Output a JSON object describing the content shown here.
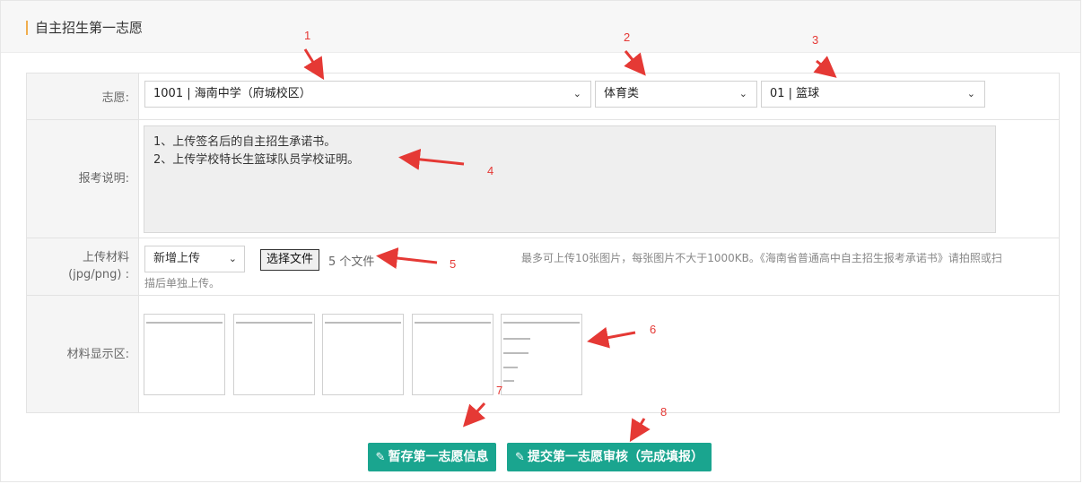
{
  "header": {
    "title": "自主招生第一志愿"
  },
  "form": {
    "choice": {
      "label": "志愿:",
      "school_value": "1001 | 海南中学（府城校区）",
      "category_value": "体育类",
      "item_value": "01 | 篮球"
    },
    "description": {
      "label": "报考说明:",
      "lines": [
        "1、上传签名后的自主招生承诺书。",
        "2、上传学校特长生篮球队员学校证明。"
      ]
    },
    "upload": {
      "label_line1": "上传材料",
      "label_line2": "(jpg/png) :",
      "mode_value": "新增上传",
      "file_button_label": "选择文件",
      "file_count": "5 个文件",
      "hint_line1": "最多可上传10张图片，每张图片不大于1000KB。《海南省普通高中自主招生报考承诺书》请拍照或扫",
      "hint_line2": "描后单独上传。"
    },
    "materials": {
      "label": "材料显示区:",
      "thumbnails": 5
    }
  },
  "buttons": {
    "save_label": "暂存第一志愿信息",
    "submit_label": "提交第一志愿审核（完成填报）"
  },
  "annotations": [
    "1",
    "2",
    "3",
    "4",
    "5",
    "6",
    "7",
    "8"
  ],
  "colors": {
    "accent": "#1aa58f",
    "annotation": "#e53935",
    "title_bar": "#f0ad4e"
  }
}
